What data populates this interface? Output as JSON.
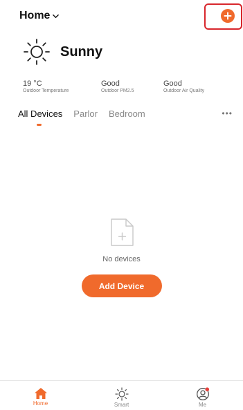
{
  "header": {
    "home_label": "Home",
    "chevron_icon": "chevron-down-icon",
    "add_icon": "plus-circle-icon",
    "accent": "#f06a2c",
    "highlight_color": "#d8262c"
  },
  "weather": {
    "icon": "sun-icon",
    "condition": "Sunny",
    "stats": [
      {
        "value": "19 °C",
        "label": "Outdoor Temperature"
      },
      {
        "value": "Good",
        "label": "Outdoor PM2.5"
      },
      {
        "value": "Good",
        "label": "Outdoor Air Quality"
      }
    ]
  },
  "rooms": {
    "tabs": [
      "All Devices",
      "Parlor",
      "Bedroom"
    ],
    "active": "All Devices",
    "more_icon": "ellipsis-icon"
  },
  "empty_state": {
    "icon": "empty-document-icon",
    "message": "No devices",
    "button": "Add Device"
  },
  "tabbar": {
    "items": [
      {
        "label": "Home",
        "icon": "home-icon",
        "active": true
      },
      {
        "label": "Smart",
        "icon": "sun-icon",
        "active": false
      },
      {
        "label": "Me",
        "icon": "user-profile-icon",
        "active": false,
        "badge": true
      }
    ]
  }
}
